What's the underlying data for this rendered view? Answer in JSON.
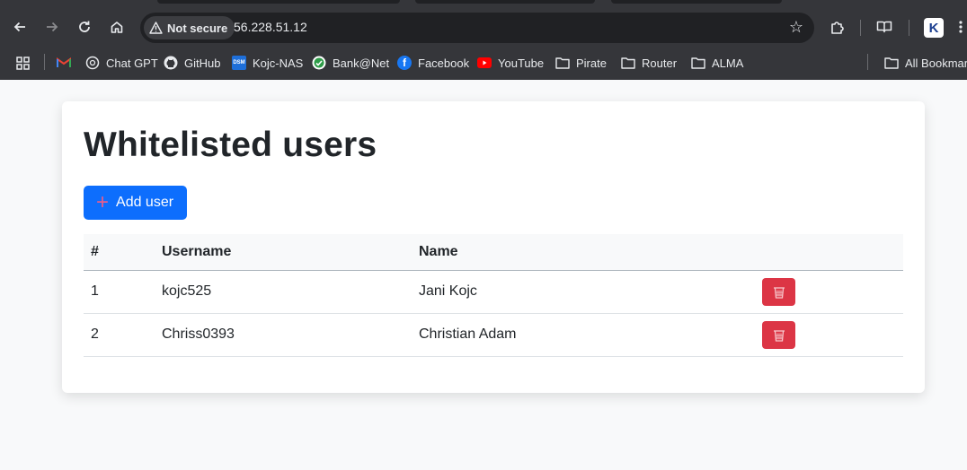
{
  "browser": {
    "security_label": "Not secure",
    "url": "56.228.51.12",
    "bookmarks": [
      {
        "label": "",
        "icon": "gmail-icon"
      },
      {
        "label": "Chat GPT",
        "icon": "openai-icon"
      },
      {
        "label": "GitHub",
        "icon": "github-icon"
      },
      {
        "label": "Kojc-NAS",
        "icon": "dsm-icon"
      },
      {
        "label": "Bank@Net",
        "icon": "bank-icon"
      },
      {
        "label": "Facebook",
        "icon": "facebook-icon"
      },
      {
        "label": "YouTube",
        "icon": "youtube-icon"
      },
      {
        "label": "Pirate",
        "icon": "folder-icon"
      },
      {
        "label": "Router",
        "icon": "folder-icon"
      },
      {
        "label": "ALMA",
        "icon": "folder-icon"
      }
    ],
    "all_bookmarks_label": "All Bookmarks",
    "profile_initial": "K"
  },
  "page": {
    "title": "Whitelisted users",
    "add_button_label": "Add user",
    "table": {
      "headers": [
        "#",
        "Username",
        "Name",
        ""
      ],
      "rows": [
        {
          "index": "1",
          "username": "kojc525",
          "name": "Jani Kojc"
        },
        {
          "index": "2",
          "username": "Chriss0393",
          "name": "Christian Adam"
        }
      ]
    }
  },
  "colors": {
    "primary": "#0d6efd",
    "danger": "#dc3545",
    "chrome_bg": "#35363a"
  }
}
